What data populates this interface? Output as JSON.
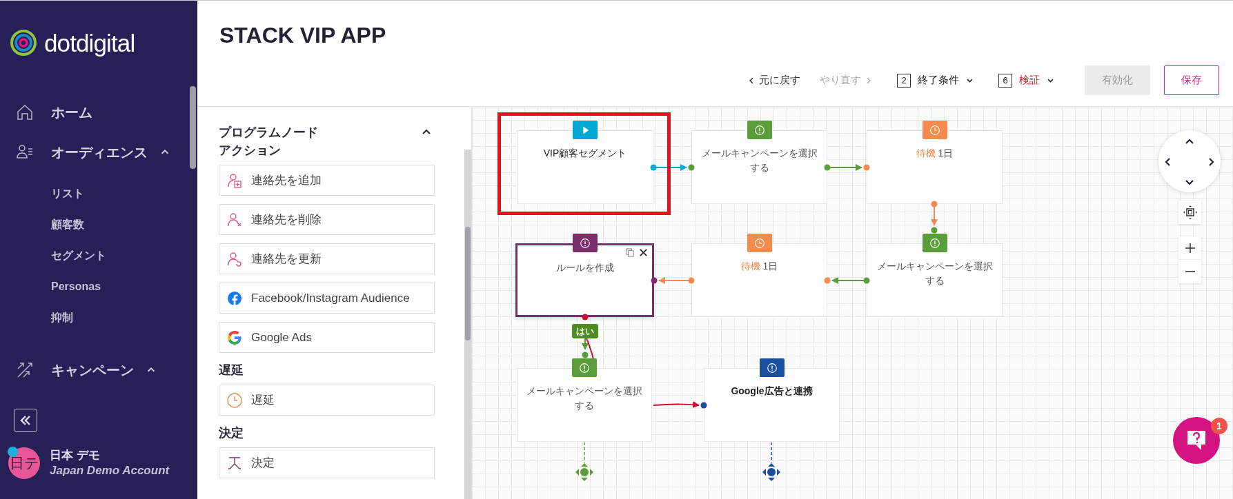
{
  "sidebar": {
    "logo": "dotdigital",
    "nav": [
      {
        "kind": "link",
        "label": "ホーム"
      },
      {
        "kind": "group",
        "label": "オーディエンス",
        "expanded": true,
        "children": [
          {
            "label": "リスト"
          },
          {
            "label": "顧客数"
          },
          {
            "label": "セグメント"
          },
          {
            "label": "Personas"
          },
          {
            "label": "抑制"
          }
        ]
      },
      {
        "kind": "group",
        "label": "キャンペーン",
        "expanded": true
      }
    ],
    "user": {
      "initials": "日テ",
      "name": "日本 デモ",
      "account": "Japan Demo Account",
      "online": true
    }
  },
  "header": {
    "title": "STACK VIP APP",
    "undo": {
      "label": "元に戻す",
      "disabled": false
    },
    "redo": {
      "label": "やり直す",
      "disabled": true
    },
    "counters": [
      {
        "count": "2",
        "label": "終了条件",
        "error": false
      },
      {
        "count": "6",
        "label": "検証",
        "error": true
      }
    ],
    "buttons": [
      {
        "label": "有効化",
        "kind": "secondary",
        "disabled": true
      },
      {
        "label": "保存",
        "kind": "primary",
        "disabled": false
      }
    ]
  },
  "palette": {
    "title": "プログラムノード",
    "expanded": true,
    "sections": [
      {
        "heading": "アクション",
        "items": [
          {
            "label": "連絡先を追加"
          },
          {
            "label": "連絡先を削除"
          },
          {
            "label": "連絡先を更新"
          },
          {
            "label": "Facebook/Instagram Audience"
          },
          {
            "label": "Google Ads"
          }
        ]
      },
      {
        "heading": "遅延",
        "items": [
          {
            "label": "遅延"
          }
        ]
      },
      {
        "heading": "決定",
        "items": [
          {
            "label": "決定"
          }
        ]
      }
    ]
  },
  "canvas": {
    "nodes": [
      {
        "kind": "start",
        "label": "VIP顧客セグメント",
        "selected": false,
        "highlighted": true
      },
      {
        "kind": "email",
        "label": "メールキャンペーンを選択する",
        "selected": false,
        "highlighted": false
      },
      {
        "kind": "wait",
        "action": "待機",
        "value": "1日",
        "selected": false,
        "highlighted": false
      },
      {
        "kind": "rule",
        "label": "ルールを作成",
        "selected": true,
        "highlighted": false
      },
      {
        "kind": "wait",
        "action": "待機",
        "value": "1日",
        "selected": false,
        "highlighted": false
      },
      {
        "kind": "email",
        "label": "メールキャンペーンを選択する",
        "selected": false,
        "highlighted": false
      },
      {
        "kind": "email",
        "label": "メールキャンペーンを選択する",
        "selected": false,
        "highlighted": false
      },
      {
        "kind": "google",
        "label": "Google広告と連携",
        "selected": false,
        "highlighted": false
      }
    ],
    "branch_label": "はい",
    "help": {
      "badge": "1"
    }
  }
}
